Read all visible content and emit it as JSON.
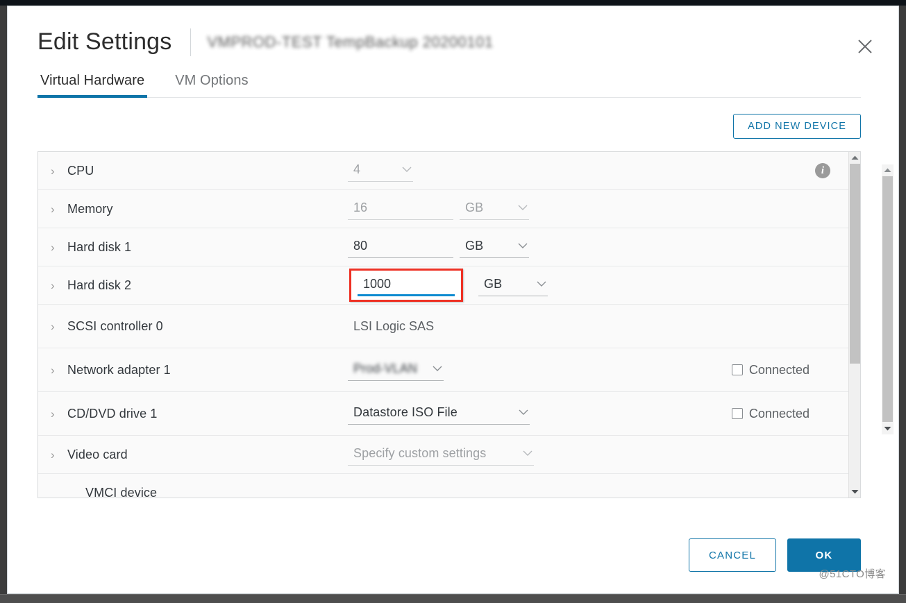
{
  "window": {
    "title": "Edit Settings",
    "vm_name": "VMPROD-TEST TempBackup 20200101",
    "close_icon": "close-icon"
  },
  "tabs": [
    {
      "label": "Virtual Hardware",
      "active": true
    },
    {
      "label": "VM Options",
      "active": false
    }
  ],
  "toolbar": {
    "add_new_device_label": "ADD NEW DEVICE"
  },
  "devices": [
    {
      "name": "CPU",
      "value": "4",
      "unit": null,
      "kind": "select",
      "dim": true,
      "info_icon": "info-icon",
      "expandable": true
    },
    {
      "name": "Memory",
      "value": "16",
      "unit": "GB",
      "kind": "input-unit",
      "dim": true,
      "expandable": true
    },
    {
      "name": "Hard disk 1",
      "value": "80",
      "unit": "GB",
      "kind": "input-unit",
      "dim": false,
      "expandable": true
    },
    {
      "name": "Hard disk 2",
      "value": "1000",
      "unit": "GB",
      "kind": "input-unit-focused",
      "dim": false,
      "focused": true,
      "expandable": true
    },
    {
      "name": "SCSI controller 0",
      "value": "LSI Logic SAS",
      "kind": "static",
      "expandable": true
    },
    {
      "name": "Network adapter 1",
      "value": "Prod-VLAN",
      "kind": "select-blurred",
      "blurred": true,
      "checkbox_label": "Connected",
      "checked": false,
      "expandable": true
    },
    {
      "name": "CD/DVD drive 1",
      "value": "Datastore ISO File",
      "kind": "select",
      "dim": false,
      "checkbox_label": "Connected",
      "checked": false,
      "expandable": true
    },
    {
      "name": "Video card",
      "value": "Specify custom settings",
      "kind": "select",
      "dim": true,
      "expandable": true
    },
    {
      "name": "VMCI device",
      "value": "",
      "kind": "none",
      "expandable": false
    }
  ],
  "footer": {
    "cancel_label": "CANCEL",
    "ok_label": "OK"
  },
  "watermark": "@51CTO博客",
  "colors": {
    "accent": "#0f74a8",
    "focus_underline": "#0f8bd0",
    "annotation": "#ee3124",
    "text": "#33383d",
    "muted": "#9ea1a4"
  }
}
